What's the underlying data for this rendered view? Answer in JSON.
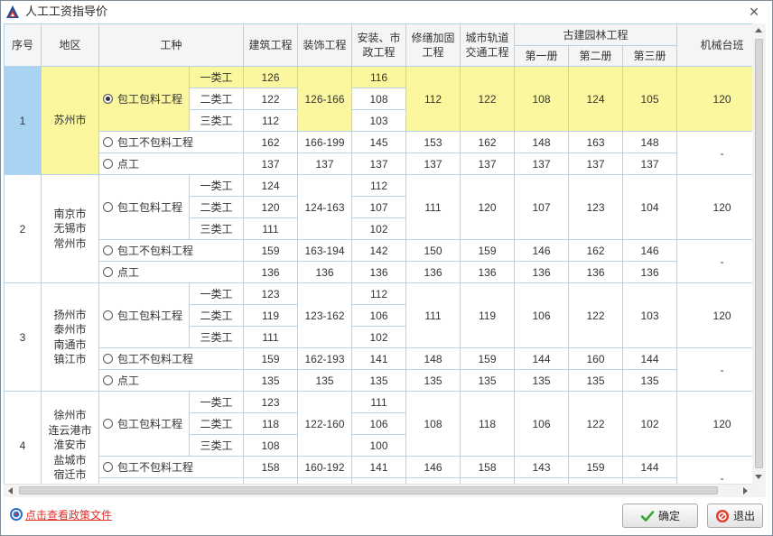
{
  "window": {
    "title": "人工工资指导价",
    "close_label": "×"
  },
  "icons": {
    "app_logo": "app-logo-icon",
    "close": "close-icon",
    "policy_link": "help-doc-icon",
    "ok": "checkmark-icon",
    "exit": "exit-icon"
  },
  "colors": {
    "grid": "#b5d3e8",
    "highlight": "#fbf79e",
    "selected_marker": "#a8d3f3",
    "header_bg": "#f3f5f7",
    "link": "#e0302a",
    "ok_icon": "#3aa635",
    "exit_icon": "#e23b2e"
  },
  "table": {
    "headers": {
      "no": "序号",
      "region": "地区",
      "work_type": "工种",
      "construction": "建筑工程",
      "decoration": "装饰工程",
      "installation": "安装、市政工程",
      "repair": "修缮加固工程",
      "rail": "城市轨道交通工程",
      "ancient": "古建园林工程",
      "vol1": "第一册",
      "vol2": "第二册",
      "vol3": "第三册",
      "machine": "机械台班"
    },
    "groups": [
      {
        "no": "1",
        "regions": [
          "苏州市"
        ],
        "selected": true,
        "contract_full": {
          "label": "包工包料工程",
          "checked": true,
          "classes": [
            {
              "label": "一类工",
              "construction": "126",
              "installation": "116",
              "selected": true
            },
            {
              "label": "二类工",
              "construction": "122",
              "installation": "108",
              "selected": false
            },
            {
              "label": "三类工",
              "construction": "112",
              "installation": "103",
              "selected": false
            }
          ],
          "decoration": "126-166",
          "repair": "112",
          "rail": "122",
          "ancient": [
            "108",
            "124",
            "105"
          ],
          "machine": "120"
        },
        "contract_labor": {
          "label": "包工不包料工程",
          "checked": false,
          "values": [
            "162",
            "166-199",
            "145",
            "153",
            "162",
            "148",
            "163",
            "148"
          ]
        },
        "day_work": {
          "label": "点工",
          "checked": false,
          "values": [
            "137",
            "137",
            "137",
            "137",
            "137",
            "137",
            "137",
            "137"
          ]
        },
        "machine_other": "-"
      },
      {
        "no": "2",
        "regions": [
          "南京市",
          "无锡市",
          "常州市"
        ],
        "selected": false,
        "contract_full": {
          "label": "包工包料工程",
          "checked": false,
          "classes": [
            {
              "label": "一类工",
              "construction": "124",
              "installation": "112",
              "selected": false
            },
            {
              "label": "二类工",
              "construction": "120",
              "installation": "107",
              "selected": false
            },
            {
              "label": "三类工",
              "construction": "111",
              "installation": "102",
              "selected": false
            }
          ],
          "decoration": "124-163",
          "repair": "111",
          "rail": "120",
          "ancient": [
            "107",
            "123",
            "104"
          ],
          "machine": "120"
        },
        "contract_labor": {
          "label": "包工不包料工程",
          "checked": false,
          "values": [
            "159",
            "163-194",
            "142",
            "150",
            "159",
            "146",
            "162",
            "146"
          ]
        },
        "day_work": {
          "label": "点工",
          "checked": false,
          "values": [
            "136",
            "136",
            "136",
            "136",
            "136",
            "136",
            "136",
            "136"
          ]
        },
        "machine_other": "-"
      },
      {
        "no": "3",
        "regions": [
          "扬州市",
          "泰州市",
          "南通市",
          "镇江市"
        ],
        "selected": false,
        "contract_full": {
          "label": "包工包料工程",
          "checked": false,
          "classes": [
            {
              "label": "一类工",
              "construction": "123",
              "installation": "112",
              "selected": false
            },
            {
              "label": "二类工",
              "construction": "119",
              "installation": "106",
              "selected": false
            },
            {
              "label": "三类工",
              "construction": "111",
              "installation": "102",
              "selected": false
            }
          ],
          "decoration": "123-162",
          "repair": "111",
          "rail": "119",
          "ancient": [
            "106",
            "122",
            "103"
          ],
          "machine": "120"
        },
        "contract_labor": {
          "label": "包工不包料工程",
          "checked": false,
          "values": [
            "159",
            "162-193",
            "141",
            "148",
            "159",
            "144",
            "160",
            "144"
          ]
        },
        "day_work": {
          "label": "点工",
          "checked": false,
          "values": [
            "135",
            "135",
            "135",
            "135",
            "135",
            "135",
            "135",
            "135"
          ]
        },
        "machine_other": "-"
      },
      {
        "no": "4",
        "regions": [
          "徐州市",
          "连云港市",
          "淮安市",
          "盐城市",
          "宿迁市"
        ],
        "selected": false,
        "contract_full": {
          "label": "包工包料工程",
          "checked": false,
          "classes": [
            {
              "label": "一类工",
              "construction": "123",
              "installation": "111",
              "selected": false
            },
            {
              "label": "二类工",
              "construction": "118",
              "installation": "106",
              "selected": false
            },
            {
              "label": "三类工",
              "construction": "108",
              "installation": "100",
              "selected": false
            }
          ],
          "decoration": "122-160",
          "repair": "108",
          "rail": "118",
          "ancient": [
            "106",
            "122",
            "102"
          ],
          "machine": "120"
        },
        "contract_labor": {
          "label": "包工不包料工程",
          "checked": false,
          "values": [
            "158",
            "160-192",
            "141",
            "146",
            "158",
            "143",
            "159",
            "144"
          ]
        },
        "day_work": {
          "checked": false,
          "values": []
        },
        "machine_other": "-"
      }
    ]
  },
  "footer": {
    "policy_link": "点击查看政策文件",
    "ok_button": "确定",
    "exit_button": "退出"
  }
}
